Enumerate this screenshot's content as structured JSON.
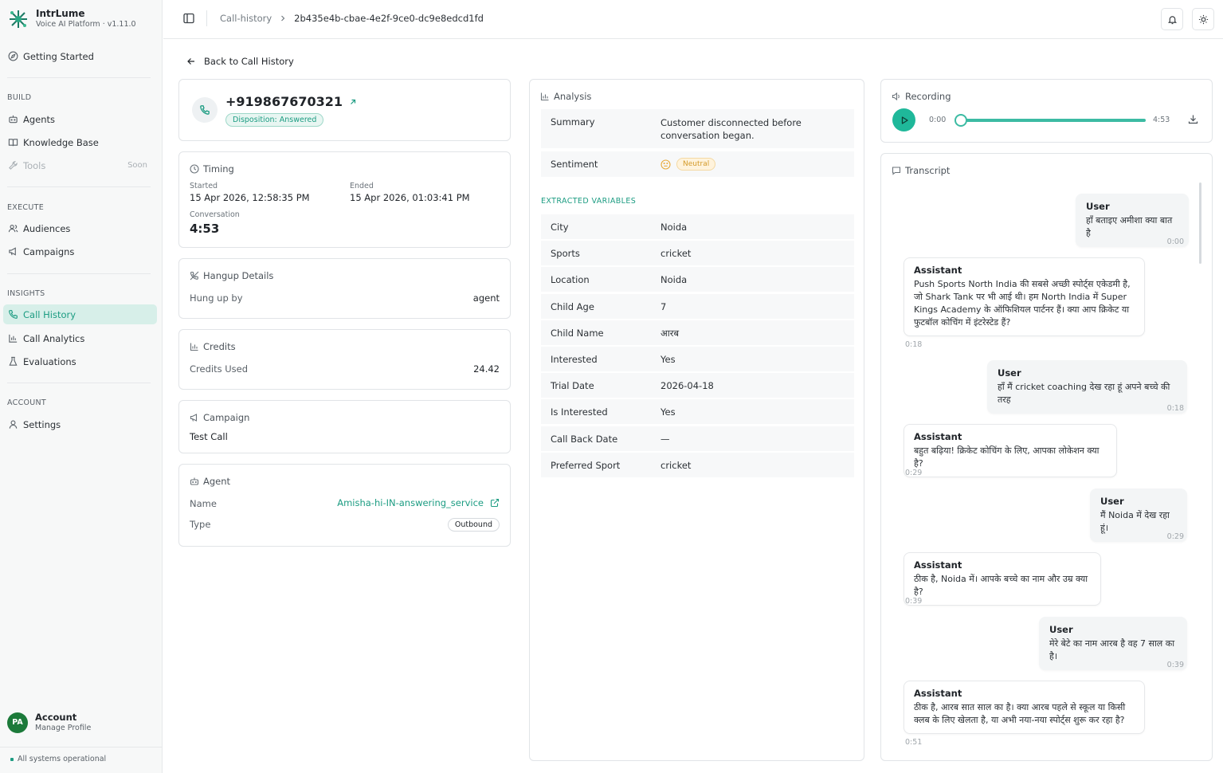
{
  "brand": {
    "name": "IntrLume",
    "subtitle": "Voice AI Platform · v1.11.0"
  },
  "sidebar": {
    "getting_started": "Getting Started",
    "sections": {
      "build": "BUILD",
      "execute": "EXECUTE",
      "insights": "INSIGHTS",
      "account": "ACCOUNT"
    },
    "items": {
      "agents": "Agents",
      "knowledge_base": "Knowledge Base",
      "tools": "Tools",
      "tools_badge": "Soon",
      "audiences": "Audiences",
      "campaigns": "Campaigns",
      "call_history": "Call History",
      "call_analytics": "Call Analytics",
      "evaluations": "Evaluations",
      "settings": "Settings"
    },
    "account": {
      "initials": "PA",
      "name": "Account",
      "subtitle": "Manage Profile"
    },
    "status": "All systems operational"
  },
  "topbar": {
    "breadcrumb_parent": "Call-history",
    "breadcrumb_current": "2b435e4b-cbae-4e2f-9ce0-dc9e8edcd1fd"
  },
  "back_label": "Back to Call History",
  "call": {
    "phone": "+919867670321",
    "disposition": "Disposition: Answered"
  },
  "timing": {
    "title": "Timing",
    "started_label": "Started",
    "started": "15 Apr 2026, 12:58:35 PM",
    "ended_label": "Ended",
    "ended": "15 Apr 2026, 01:03:41 PM",
    "conversation_label": "Conversation",
    "conversation": "4:53"
  },
  "hangup": {
    "title": "Hangup Details",
    "label": "Hung up by",
    "value": "agent"
  },
  "credits": {
    "title": "Credits",
    "label": "Credits Used",
    "value": "24.42"
  },
  "campaign": {
    "title": "Campaign",
    "value": "Test Call"
  },
  "agent": {
    "title": "Agent",
    "name_label": "Name",
    "name": "Amisha-hi-IN-answering_service",
    "type_label": "Type",
    "type": "Outbound"
  },
  "analysis": {
    "title": "Analysis",
    "summary_label": "Summary",
    "summary": "Customer disconnected before conversation began.",
    "sentiment_label": "Sentiment",
    "sentiment": "Neutral",
    "extracted_title": "EXTRACTED VARIABLES",
    "variables": [
      {
        "key": "City",
        "value": "Noida"
      },
      {
        "key": "Sports",
        "value": "cricket"
      },
      {
        "key": "Location",
        "value": "Noida"
      },
      {
        "key": "Child Age",
        "value": "7"
      },
      {
        "key": "Child Name",
        "value": "आरब"
      },
      {
        "key": "Interested",
        "value": "Yes"
      },
      {
        "key": "Trial Date",
        "value": "2026-04-18"
      },
      {
        "key": "Is Interested",
        "value": "Yes"
      },
      {
        "key": "Call Back Date",
        "value": "—"
      },
      {
        "key": "Preferred Sport",
        "value": "cricket"
      }
    ]
  },
  "recording": {
    "title": "Recording",
    "current": "0:00",
    "duration": "4:53",
    "progress": 0
  },
  "transcript": {
    "title": "Transcript",
    "messages": [
      {
        "role": "User",
        "text": "हाँ बताइए अमीशा क्या बात है",
        "time": "0:00"
      },
      {
        "role": "Assistant",
        "text": "Push Sports North India की सबसे अच्छी स्पोर्ट्स एकेडमी है, जो Shark Tank पर भी आई थी। हम North India में Super Kings Academy के ऑफिशियल पार्टनर हैं। क्या आप क्रिकेट या फुटबॉल कोचिंग में इंटरेस्टेड हैं?",
        "time": "0:18"
      },
      {
        "role": "User",
        "text": "हाँ मैं cricket coaching देख रहा हूं अपने बच्चे की तरह",
        "time": "0:18"
      },
      {
        "role": "Assistant",
        "text": "बहुत बढ़िया! क्रिकेट कोचिंग के लिए, आपका लोकेशन क्या है?",
        "time": "0:29"
      },
      {
        "role": "User",
        "text": "मैं Noida में देख रहा हूं।",
        "time": "0:29"
      },
      {
        "role": "Assistant",
        "text": "ठीक है, Noida में। आपके बच्चे का नाम और उम्र क्या है?",
        "time": "0:39"
      },
      {
        "role": "User",
        "text": "मेरे बेटे का नाम आरब है वह 7 साल का है।",
        "time": "0:39"
      },
      {
        "role": "Assistant",
        "text": "ठीक है, आरब सात साल का है। क्या आरब पहले से स्कूल या किसी क्लब के लिए खेलता है, या अभी नया-नया स्पोर्ट्स शुरू कर रहा है?",
        "time": "0:51"
      }
    ]
  },
  "colors": {
    "accent": "#1c9c82",
    "play": "#1fb89a",
    "neutral": "#d39a2a"
  }
}
